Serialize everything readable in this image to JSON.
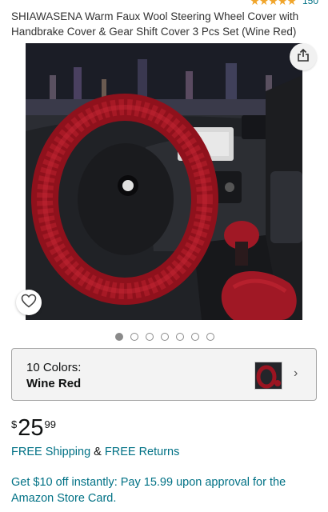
{
  "rating": {
    "stars": "★★★★★",
    "review_count": "150"
  },
  "product": {
    "title": "SHIAWASENA Warm Faux Wool Steering Wheel Cover with Handbrake Cover & Gear Shift Cover 3 Pcs Set (Wine Red)"
  },
  "gallery": {
    "image_count": 7,
    "active_index": 0
  },
  "icons": {
    "share": "share-icon",
    "heart": "heart-icon",
    "chevron": "chevron-right-icon"
  },
  "variation": {
    "count_label": "10 Colors:",
    "selected": "Wine Red",
    "chevron": "›"
  },
  "price": {
    "currency": "$",
    "whole": "25",
    "fraction": "99"
  },
  "shipping": {
    "free_shipping": "FREE Shipping",
    "ampersand": "&",
    "free_returns": "FREE Returns"
  },
  "promo": {
    "text": "Get $10 off instantly: Pay 15.99 upon approval for the Amazon Store Card."
  },
  "colors": {
    "link": "#007185",
    "star": "#f0a52b",
    "product_red": "#9b1421"
  }
}
